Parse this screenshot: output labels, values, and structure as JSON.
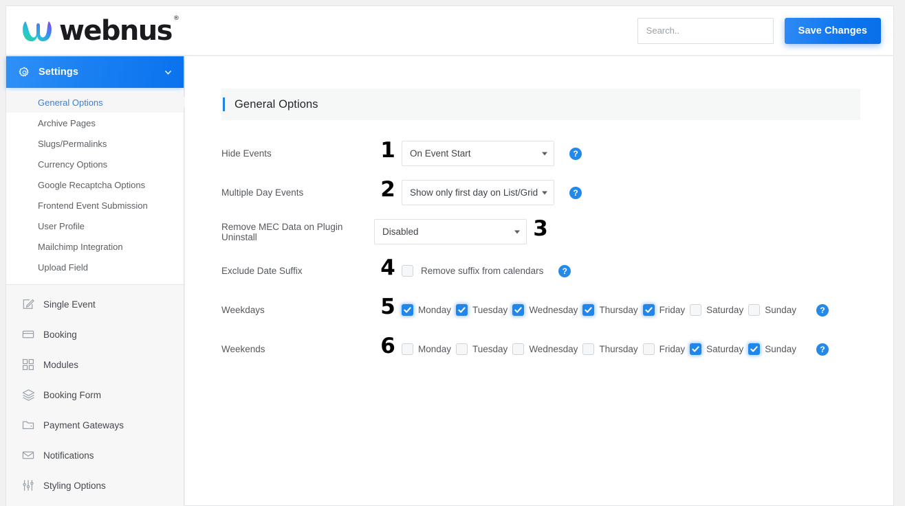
{
  "brand": {
    "logo_text": "webnus",
    "registered_mark": "®",
    "logo_icon": "webnus-w-logo"
  },
  "topbar": {
    "search_placeholder": "Search..",
    "search_value": "",
    "save_label": "Save Changes"
  },
  "sidebar": {
    "settings": {
      "label": "Settings",
      "icon": "gear-icon",
      "chevron": "chevron-down-icon",
      "expanded": true
    },
    "submenu": [
      {
        "label": "General Options",
        "active": true
      },
      {
        "label": "Archive Pages",
        "active": false
      },
      {
        "label": "Slugs/Permalinks",
        "active": false
      },
      {
        "label": "Currency Options",
        "active": false
      },
      {
        "label": "Google Recaptcha Options",
        "active": false
      },
      {
        "label": "Frontend Event Submission",
        "active": false
      },
      {
        "label": "User Profile",
        "active": false
      },
      {
        "label": "Mailchimp Integration",
        "active": false
      },
      {
        "label": "Upload Field",
        "active": false
      }
    ],
    "menu": [
      {
        "label": "Single Event",
        "icon": "edit-square-icon"
      },
      {
        "label": "Booking",
        "icon": "card-icon"
      },
      {
        "label": "Modules",
        "icon": "grid-icon"
      },
      {
        "label": "Booking Form",
        "icon": "layers-icon"
      },
      {
        "label": "Payment Gateways",
        "icon": "folder-icon"
      },
      {
        "label": "Notifications",
        "icon": "envelope-icon"
      },
      {
        "label": "Styling Options",
        "icon": "sliders-icon"
      }
    ]
  },
  "panel": {
    "title": "General Options"
  },
  "form": {
    "help_glyph": "?",
    "rows": [
      {
        "label": "Hide Events",
        "step": "1",
        "type": "select",
        "value": "On Event Start",
        "help": true
      },
      {
        "label": "Multiple Day Events",
        "step": "2",
        "type": "select",
        "value": "Show only first day on List/Grid",
        "help": true
      },
      {
        "label": "Remove MEC Data on Plugin Uninstall",
        "step": "3",
        "step_side": "right",
        "type": "select",
        "value": "Disabled",
        "help": false
      },
      {
        "label": "Exclude Date Suffix",
        "step": "4",
        "type": "checkbox",
        "checkbox_label": "Remove suffix from calendars",
        "checked": false,
        "help": true
      },
      {
        "label": "Weekdays",
        "step": "5",
        "type": "daygroup",
        "help": true,
        "days": [
          {
            "label": "Monday",
            "checked": true
          },
          {
            "label": "Tuesday",
            "checked": true
          },
          {
            "label": "Wednesday",
            "checked": true
          },
          {
            "label": "Thursday",
            "checked": true
          },
          {
            "label": "Friday",
            "checked": true
          },
          {
            "label": "Saturday",
            "checked": false
          },
          {
            "label": "Sunday",
            "checked": false
          }
        ]
      },
      {
        "label": "Weekends",
        "step": "6",
        "type": "daygroup",
        "help": true,
        "days": [
          {
            "label": "Monday",
            "checked": false
          },
          {
            "label": "Tuesday",
            "checked": false
          },
          {
            "label": "Wednesday",
            "checked": false
          },
          {
            "label": "Thursday",
            "checked": false
          },
          {
            "label": "Friday",
            "checked": false
          },
          {
            "label": "Saturday",
            "checked": true
          },
          {
            "label": "Sunday",
            "checked": true
          }
        ]
      }
    ]
  },
  "colors": {
    "accent_blue": "#1f86ec",
    "save_button": "#0d75ee",
    "active_link": "#3b7fd4",
    "help_icon": "#2489e8",
    "panel_header_bg": "#f6f7f7",
    "sidebar_bg": "#f7f7f8"
  }
}
